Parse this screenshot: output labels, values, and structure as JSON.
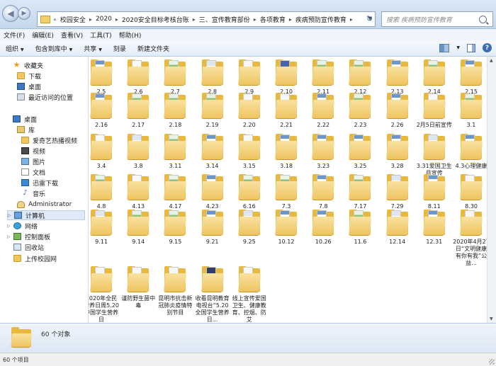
{
  "address": {
    "crumbs": [
      "校园安全",
      "2020",
      "2020安全目标考核台账",
      "三、宣传教育部份",
      "各项教育",
      "疾病预防宣传教育"
    ],
    "overflow": "«"
  },
  "search": {
    "placeholder": "搜索 疾病预防宣传教育"
  },
  "menu": [
    "文件(F)",
    "编辑(E)",
    "查看(V)",
    "工具(T)",
    "帮助(H)"
  ],
  "toolbar": {
    "organize": "组织",
    "include": "包含到库中",
    "share": "共享",
    "burn": "刻录",
    "new_folder": "新建文件夹"
  },
  "nav": {
    "favorites": "收藏夹",
    "downloads": "下载",
    "desktop_fav": "桌面",
    "recent": "最近访问的位置",
    "desktop": "桌面",
    "libraries": "库",
    "iqiyi": "爱奇艺热播视频",
    "videos": "视频",
    "pictures": "图片",
    "documents": "文档",
    "xunlei": "迅雷下载",
    "music": "音乐",
    "admin": "Administrator",
    "computer": "计算机",
    "network": "网络",
    "control_panel": "控制面板",
    "recycle": "回收站",
    "upload": "上传校园网"
  },
  "folders": [
    {
      "name": "2.5",
      "paper": "doc1"
    },
    {
      "name": "2.6",
      "paper": "plain"
    },
    {
      "name": "2.7",
      "paper": "doc2"
    },
    {
      "name": "2.8",
      "paper": "doc4"
    },
    {
      "name": "2.9",
      "paper": "plain"
    },
    {
      "name": "2.10",
      "paper": "doc3"
    },
    {
      "name": "2.11",
      "paper": "doc2"
    },
    {
      "name": "2.12",
      "paper": "doc2"
    },
    {
      "name": "2.13",
      "paper": "doc1"
    },
    {
      "name": "2.14",
      "paper": "doc2"
    },
    {
      "name": "2.15",
      "paper": "doc1"
    },
    {
      "name": "2.16",
      "paper": "doc1"
    },
    {
      "name": "2.17",
      "paper": "doc2"
    },
    {
      "name": "2.18",
      "paper": "doc2"
    },
    {
      "name": "2.19",
      "paper": "doc2"
    },
    {
      "name": "2.20",
      "paper": "plain"
    },
    {
      "name": "2.21",
      "paper": "plain"
    },
    {
      "name": "2.22",
      "paper": "doc1"
    },
    {
      "name": "2.23",
      "paper": "doc2"
    },
    {
      "name": "2.26",
      "paper": "doc1"
    },
    {
      "name": "2月5日前宣传",
      "paper": "plain"
    },
    {
      "name": "3.1",
      "paper": "doc2"
    },
    {
      "name": "3.4",
      "paper": "plain"
    },
    {
      "name": "3.8",
      "paper": "doc4"
    },
    {
      "name": "3.11",
      "paper": "doc2"
    },
    {
      "name": "3.14",
      "paper": "doc1"
    },
    {
      "name": "3.15",
      "paper": "plain"
    },
    {
      "name": "3.18",
      "paper": "doc1"
    },
    {
      "name": "3.23",
      "paper": "doc1"
    },
    {
      "name": "3.25",
      "paper": "doc1"
    },
    {
      "name": "3.28",
      "paper": "doc1"
    },
    {
      "name": "3.31爱国卫生月宣传",
      "paper": "doc4"
    },
    {
      "name": "4.3心理健康",
      "paper": "doc1"
    },
    {
      "name": "4.8",
      "paper": "doc2"
    },
    {
      "name": "4.13",
      "paper": "plain"
    },
    {
      "name": "4.17",
      "paper": "doc2"
    },
    {
      "name": "4.23",
      "paper": "doc1"
    },
    {
      "name": "6.16",
      "paper": "doc2"
    },
    {
      "name": "7.3",
      "paper": "doc2"
    },
    {
      "name": "7.8",
      "paper": "doc1"
    },
    {
      "name": "7.17",
      "paper": "doc2"
    },
    {
      "name": "7.29",
      "paper": "doc4"
    },
    {
      "name": "8.11",
      "paper": "doc1"
    },
    {
      "name": "8.30",
      "paper": "plain"
    },
    {
      "name": "9.11",
      "paper": "doc4"
    },
    {
      "name": "9.14",
      "paper": "doc2"
    },
    {
      "name": "9.15",
      "paper": "doc2"
    },
    {
      "name": "9.21",
      "paper": "doc1"
    },
    {
      "name": "9.25",
      "paper": "doc4"
    },
    {
      "name": "10.12",
      "paper": "doc1"
    },
    {
      "name": "10.26",
      "paper": "doc1"
    },
    {
      "name": "11.6",
      "paper": "doc2"
    },
    {
      "name": "12.14",
      "paper": "doc4"
    },
    {
      "name": "12.31",
      "paper": "doc1"
    },
    {
      "name": "2020年4月27日“文明健康有你有我”公益...",
      "paper": "plain"
    },
    {
      "name": "2020年全民营养日周5.20中国学生营养日",
      "paper": "plain"
    },
    {
      "name": "谨防野生菌中毒",
      "paper": "plain"
    },
    {
      "name": "昆明市抗击新冠肺炎疫情特别节目",
      "paper": "plain"
    },
    {
      "name": "收看昆明教育电视台“5.20全国学生营养日...",
      "paper": "doc5"
    },
    {
      "name": "线上宣传爱国卫生、健康教育、控烟、防艾",
      "paper": "plain"
    }
  ],
  "details": {
    "count": "60 个对象"
  },
  "status": {
    "text": "60 个项目"
  }
}
